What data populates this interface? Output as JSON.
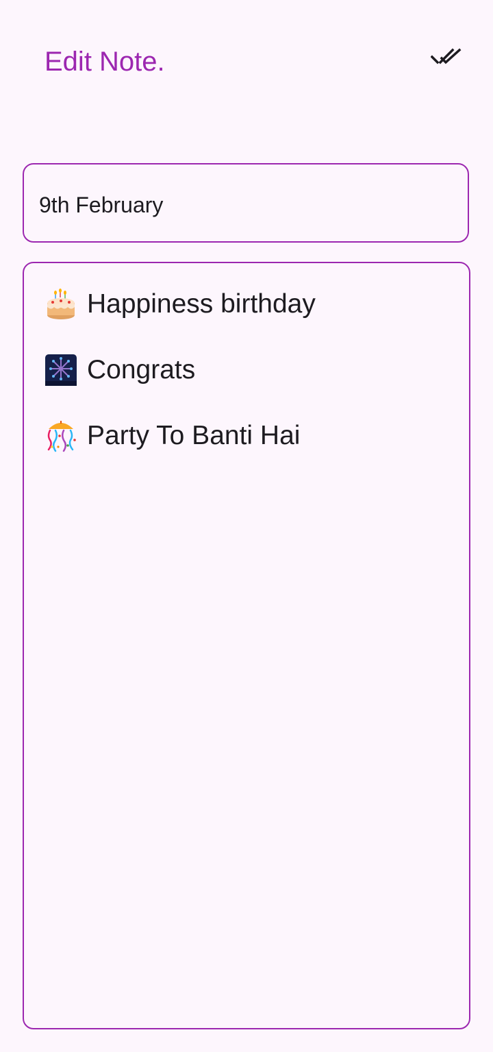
{
  "header": {
    "title": "Edit Note.",
    "done_icon": "double-check-icon"
  },
  "note": {
    "title_value": "9th February",
    "lines": [
      {
        "icon": "birthday-cake-icon",
        "text": "Happiness birthday"
      },
      {
        "icon": "fireworks-icon",
        "text": "Congrats"
      },
      {
        "icon": "confetti-ball-icon",
        "text": "Party To Banti Hai"
      }
    ]
  },
  "colors": {
    "accent": "#9c27b0",
    "background": "#fdf6fd",
    "text": "#1d1b20"
  }
}
